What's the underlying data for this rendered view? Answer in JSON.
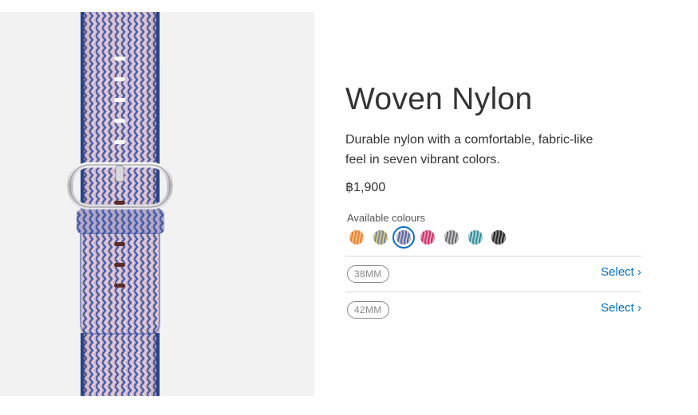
{
  "product": {
    "title": "Woven Nylon",
    "description": "Durable nylon with a comfortable, fabric-like feel in seven vibrant colors.",
    "price": "฿1,900",
    "image_icon": "woven-nylon-band-image"
  },
  "colors": {
    "label": "Available colours",
    "swatches": [
      {
        "name": "orange",
        "base": "#e8843e",
        "stripe": "#f6c98a",
        "selected": false
      },
      {
        "name": "yellow-gray",
        "base": "#7d8aa0",
        "stripe": "#e6d27a",
        "selected": false
      },
      {
        "name": "royal-blue",
        "base": "#5a6f9f",
        "stripe": "#d9c7d6",
        "selected": true
      },
      {
        "name": "pink",
        "base": "#c83a6b",
        "stripe": "#f0a6c0",
        "selected": false
      },
      {
        "name": "gray",
        "base": "#6f6f73",
        "stripe": "#d5d5d5",
        "selected": false
      },
      {
        "name": "teal",
        "base": "#3f8e9a",
        "stripe": "#b8e0e2",
        "selected": false
      },
      {
        "name": "black",
        "base": "#2a2a2a",
        "stripe": "#9a9a9a",
        "selected": false
      }
    ],
    "accent": "#0070c9"
  },
  "sizes": [
    {
      "label": "38MM",
      "action": "Select ›"
    },
    {
      "label": "42MM",
      "action": "Select ›"
    }
  ],
  "band_colors": {
    "blue": "#2f4fa2",
    "pink": "#d9b7c4",
    "buckle": "#c8c8cc"
  }
}
